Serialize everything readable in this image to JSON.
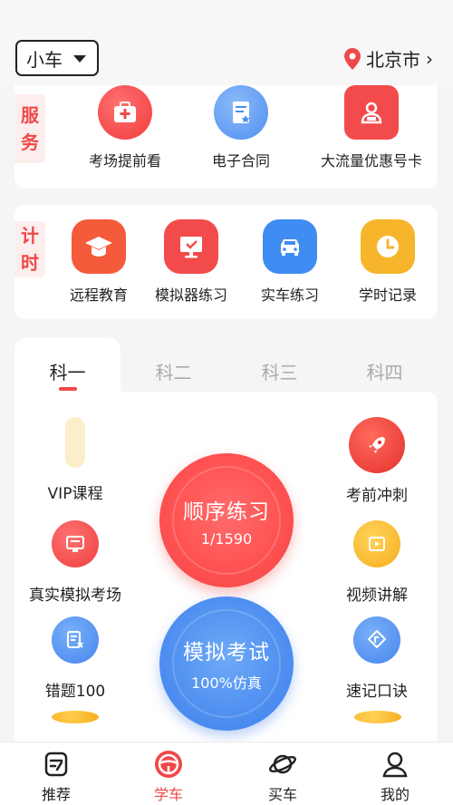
{
  "header": {
    "car_type": "小车",
    "city": "北京市"
  },
  "services": {
    "badge": [
      "服",
      "务"
    ],
    "items": [
      {
        "label": "考场提前看",
        "icon": "medical-kit-icon",
        "color": "#f34b4b"
      },
      {
        "label": "电子合同",
        "icon": "contract-icon",
        "color": "#5d9bf5"
      },
      {
        "label": "大流量优惠号卡",
        "icon": "sim-card-icon",
        "color": "#f34b4b"
      }
    ]
  },
  "timing": {
    "badge": [
      "计",
      "时"
    ],
    "items": [
      {
        "label": "远程教育",
        "icon": "graduation-cap-icon",
        "color": "#f45b3b"
      },
      {
        "label": "模拟器练习",
        "icon": "simulator-monitor-icon",
        "color": "#f34b4b"
      },
      {
        "label": "实车练习",
        "icon": "car-icon",
        "color": "#3f8cf2"
      },
      {
        "label": "学时记录",
        "icon": "clock-icon",
        "color": "#f7b52b"
      }
    ]
  },
  "subject_tabs": [
    "科一",
    "科二",
    "科三",
    "科四"
  ],
  "features_left": [
    {
      "label": "VIP课程",
      "icon": "vip-medal-icon",
      "color": "#f9e6b5"
    },
    {
      "label": "真实模拟考场",
      "icon": "exam-screen-icon",
      "color": "#f04848"
    },
    {
      "label": "错题100",
      "icon": "wrong-questions-icon",
      "color": "#4e8ff0"
    }
  ],
  "features_right": [
    {
      "label": "考前冲刺",
      "icon": "rocket-icon",
      "color": "#f04848"
    },
    {
      "label": "视频讲解",
      "icon": "video-play-icon",
      "color": "#f7b52b"
    },
    {
      "label": "速记口诀",
      "icon": "quick-memo-icon",
      "color": "#4e8ff0"
    }
  ],
  "practice": {
    "title": "顺序练习",
    "progress": "1/1590"
  },
  "exam": {
    "title": "模拟考试",
    "subtitle": "100%仿真"
  },
  "bottom_nav": [
    {
      "label": "推荐",
      "icon": "recommend-icon"
    },
    {
      "label": "学车",
      "icon": "steering-wheel-icon",
      "active": true
    },
    {
      "label": "买车",
      "icon": "planet-icon"
    },
    {
      "label": "我的",
      "icon": "user-icon"
    }
  ]
}
